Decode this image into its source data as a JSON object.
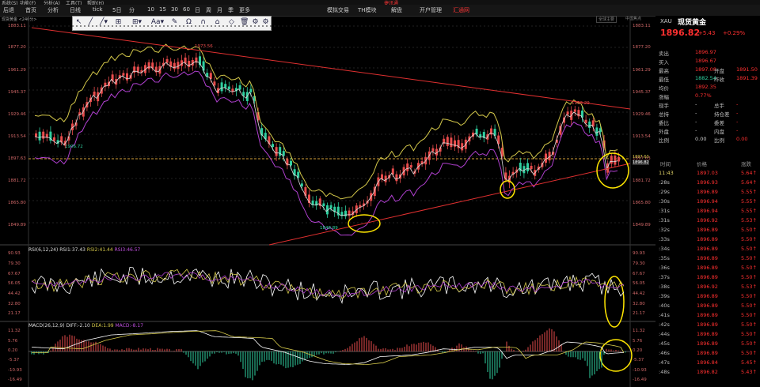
{
  "menubar": [
    "系统(S)",
    "功能(F)",
    "分析(A)",
    "工具(T)",
    "帮助(H)",
    "捷讯通"
  ],
  "toolbar": {
    "items": [
      "后退",
      "首页",
      "分析",
      "日线",
      "tick",
      "5日",
      "分",
      "10",
      "15",
      "30",
      "60",
      "日",
      "周",
      "月",
      "季",
      "更多",
      "模拟交易",
      "TH模块",
      "解盘",
      "开户管理",
      "汇通网"
    ],
    "chart_name": "现货黄金 <240分>",
    "top_right": "全球主要",
    "top_right2": "中国焦点"
  },
  "drawtools": [
    "↖",
    "╱",
    "╱▾",
    "⊞",
    "⊞▾",
    "Aa▾",
    "✎",
    "Ω",
    "∩",
    "⌂",
    "◇",
    "🗑",
    "⚙",
    "⚙"
  ],
  "price_axis": [
    "1883.11",
    "1877.20",
    "1961.29",
    "1945.37",
    "1929.46",
    "1913.54",
    "1897.63",
    "1881.72",
    "1865.80",
    "1849.89"
  ],
  "annotations": {
    "high1": "1973.56",
    "low1": "1906.72",
    "low2": "1848.89",
    "high2": "1933.29",
    "cur_label": "1897.63",
    "cur_label2": "1896.82"
  },
  "rsi": {
    "label": "RSI(6,12,24) RSI1:37.43",
    "rsi2": "RSI2:41.44",
    "rsi3": "RSI3:46.57",
    "axis": [
      "90.93",
      "79.30",
      "67.67",
      "56.05",
      "44.42",
      "32.80",
      "21.17"
    ]
  },
  "macd": {
    "label": "MACD(26,12,9) DIFF:-2.10",
    "dea": "DEA:1.99",
    "macd": "MACD:-8.17",
    "axis": [
      "11.32",
      "5.76",
      "0.20",
      "-5.37",
      "-10.93",
      "-16.49"
    ]
  },
  "quote": {
    "symbol": "XAU",
    "name": "现货黄金",
    "price": "1896.82",
    "change": "+5.43",
    "pct": "+0.29%",
    "rows": [
      [
        "卖出",
        "1896.97",
        "",
        ""
      ],
      [
        "买入",
        "1896.67",
        "",
        ""
      ],
      [
        "最高",
        "1897.08",
        "开盘",
        "1891.50"
      ],
      [
        "最低",
        "1882.54",
        "昨收",
        "1891.39"
      ],
      [
        "均价",
        "1892.35",
        "",
        ""
      ],
      [
        "涨幅",
        "0.77%",
        "",
        ""
      ],
      [
        "现手",
        "-",
        "总手",
        "-"
      ],
      [
        "总持",
        "-",
        "持仓差",
        "-"
      ],
      [
        "委比",
        "-",
        "委差",
        "-"
      ],
      [
        "外盘",
        "-",
        "内盘",
        "-"
      ],
      [
        "比例",
        "0.00",
        "比例",
        "0.00"
      ]
    ],
    "tick_header": [
      "时间",
      "价格",
      "涨跌"
    ],
    "ticks": [
      [
        "11:43",
        "1897.03",
        "5.64"
      ],
      [
        ":28s",
        "1896.93",
        "5.64"
      ],
      [
        ":29s",
        "1896.89",
        "5.55"
      ],
      [
        ":30s",
        "1896.94",
        "5.55"
      ],
      [
        ":31s",
        "1896.94",
        "5.55"
      ],
      [
        ":31s",
        "1896.92",
        "5.53"
      ],
      [
        ":32s",
        "1896.89",
        "5.50"
      ],
      [
        ":33s",
        "1896.89",
        "5.50"
      ],
      [
        ":34s",
        "1896.89",
        "5.50"
      ],
      [
        ":35s",
        "1896.89",
        "5.50"
      ],
      [
        ":36s",
        "1896.89",
        "5.50"
      ],
      [
        ":37s",
        "1896.89",
        "5.50"
      ],
      [
        ":38s",
        "1896.92",
        "5.53"
      ],
      [
        ":39s",
        "1896.89",
        "5.50"
      ],
      [
        ":40s",
        "1896.89",
        "5.50"
      ],
      [
        ":41s",
        "1896.89",
        "5.50"
      ],
      [
        ":42s",
        "1896.89",
        "5.50"
      ],
      [
        ":44s",
        "1896.89",
        "5.50"
      ],
      [
        ":45s",
        "1896.89",
        "5.50"
      ],
      [
        ":46s",
        "1896.89",
        "5.50"
      ],
      [
        ":47s",
        "1896.84",
        "5.45"
      ],
      [
        ":48s",
        "1896.82",
        "5.43"
      ]
    ]
  },
  "colors": {
    "up": "#e84c4c",
    "down": "#2fd0a0",
    "ma": "#d4c84a",
    "accent": "#ff3030"
  }
}
